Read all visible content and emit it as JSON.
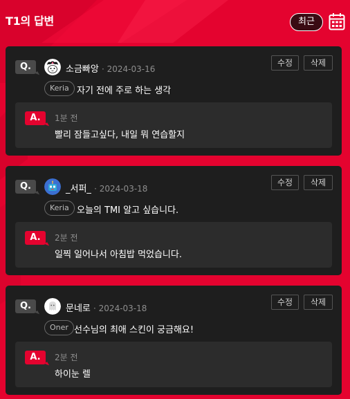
{
  "header": {
    "title": "T1의 답변",
    "recent_label": "최근"
  },
  "icons": {
    "calendar": "calendar-icon"
  },
  "colors": {
    "brand_red": "#e4032f",
    "card_bg": "#1e1e1e",
    "answer_bg": "#2c2c2c"
  },
  "buttons": {
    "edit_label": "수정",
    "delete_label": "삭제"
  },
  "badges": {
    "question": "Q.",
    "answer": "A."
  },
  "qa": [
    {
      "username": "소금빠앙",
      "date": "· 2024-03-16",
      "tag": "Keria",
      "question": "자기 전에 주로 하는 생각",
      "answer_time": "1분 전",
      "answer": "빨리 잠들고싶다, 내일 뭐 연습할지"
    },
    {
      "username": "_서퍼_",
      "date": "· 2024-03-18",
      "tag": "Keria",
      "question": "오늘의 TMI 알고 싶습니다.",
      "answer_time": "2분 전",
      "answer": "일찍 일어나서 아침밥 먹었습니다."
    },
    {
      "username": "문네로",
      "date": "· 2024-03-18",
      "tag": "Oner",
      "question": "선수님의 최애 스킨이 궁금해요!",
      "answer_time": "2분 전",
      "answer": "하이눈 렐"
    }
  ]
}
